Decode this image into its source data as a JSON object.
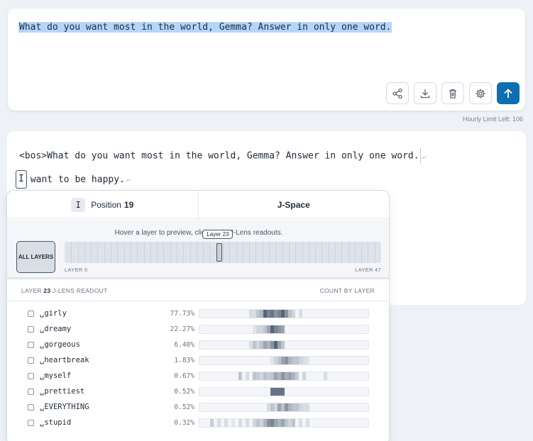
{
  "prompt": {
    "text": "What do you want most in the world, Gemma? Answer in only one word."
  },
  "toolbar": {
    "buttons": [
      "share-icon",
      "download-icon",
      "trash-icon",
      "gear-icon",
      "arrow-up-icon"
    ]
  },
  "limit_text": "Hourly Limit Left: 106",
  "output": {
    "line1": "<bos>What do you want most in the world, Gemma? Answer in only one word.",
    "newline_mark": "↵",
    "selected_token": "I",
    "line2": "want to be happy."
  },
  "panel": {
    "tab_position_chip": "I",
    "tab_position_label": "Position",
    "tab_position_value": "19",
    "tab_jspace": "J-Space",
    "hint": "Hover a layer to preview, click to pin J-Lens readouts.",
    "all_layers_label": "ALL LAYERS",
    "layer_tooltip": "Layer 23",
    "layer_min_label": "LAYER 0",
    "layer_max_label": "LAYER 47",
    "layer_count": 48,
    "selected_layer": 23,
    "readout_prefix": "LAYER",
    "readout_layer": "23",
    "readout_suffix": "J-LENS READOUT",
    "count_by_layer": "COUNT BY LAYER",
    "colors": {
      "bar": "#46546b",
      "accent": "#0d6fb0",
      "selection": "#b5d6fb"
    },
    "rows": [
      {
        "token": "␣girly",
        "pct": "77.73%",
        "layers": [
          [
            14,
            0.15
          ],
          [
            15,
            0.15
          ],
          [
            16,
            0.3
          ],
          [
            17,
            0.4
          ],
          [
            18,
            0.9
          ],
          [
            19,
            0.7
          ],
          [
            20,
            0.8
          ],
          [
            21,
            0.6
          ],
          [
            22,
            0.7
          ],
          [
            23,
            0.9
          ],
          [
            24,
            0.6
          ],
          [
            25,
            0.3
          ],
          [
            26,
            0.2
          ],
          [
            28,
            0.15
          ]
        ]
      },
      {
        "token": "␣dreamy",
        "pct": "22.27%",
        "layers": [
          [
            15,
            0.1
          ],
          [
            16,
            0.2
          ],
          [
            17,
            0.2
          ],
          [
            18,
            0.3
          ],
          [
            19,
            0.5
          ],
          [
            20,
            0.9
          ],
          [
            21,
            0.7
          ],
          [
            22,
            0.6
          ],
          [
            23,
            0.5
          ]
        ]
      },
      {
        "token": "␣gorgeous",
        "pct": "6.40%",
        "layers": [
          [
            14,
            0.15
          ],
          [
            15,
            0.3
          ],
          [
            16,
            0.2
          ],
          [
            17,
            0.3
          ],
          [
            18,
            0.5
          ],
          [
            19,
            0.4
          ],
          [
            20,
            0.6
          ],
          [
            21,
            0.9
          ],
          [
            22,
            0.5
          ],
          [
            23,
            0.3
          ]
        ]
      },
      {
        "token": "␣heartbreak",
        "pct": "1.83%",
        "layers": [
          [
            20,
            0.1
          ],
          [
            21,
            0.2
          ],
          [
            22,
            0.3
          ],
          [
            23,
            0.5
          ],
          [
            24,
            0.6
          ],
          [
            25,
            0.4
          ],
          [
            26,
            0.3
          ],
          [
            27,
            0.3
          ],
          [
            28,
            0.2
          ],
          [
            29,
            0.15
          ],
          [
            30,
            0.1
          ]
        ]
      },
      {
        "token": "␣myself",
        "pct": "0.67%",
        "layers": [
          [
            11,
            0.3
          ],
          [
            13,
            0.15
          ],
          [
            15,
            0.3
          ],
          [
            16,
            0.25
          ],
          [
            17,
            0.2
          ],
          [
            18,
            0.3
          ],
          [
            19,
            0.25
          ],
          [
            20,
            0.3
          ],
          [
            21,
            0.5
          ],
          [
            22,
            0.4
          ],
          [
            23,
            0.6
          ],
          [
            24,
            0.45
          ],
          [
            25,
            0.5
          ],
          [
            26,
            0.4
          ],
          [
            27,
            0.25
          ],
          [
            29,
            0.2
          ],
          [
            35,
            0.15
          ]
        ]
      },
      {
        "token": "␣prettiest",
        "pct": "0.52%",
        "layers": [
          [
            20,
            0.8
          ],
          [
            21,
            0.8
          ],
          [
            22,
            0.8
          ],
          [
            23,
            0.8
          ]
        ]
      },
      {
        "token": "␣EVERYTHING",
        "pct": "0.52%",
        "layers": [
          [
            19,
            0.15
          ],
          [
            20,
            0.3
          ],
          [
            21,
            0.2
          ],
          [
            22,
            0.5
          ],
          [
            23,
            0.3
          ],
          [
            24,
            0.6
          ],
          [
            25,
            0.4
          ],
          [
            26,
            0.3
          ],
          [
            27,
            0.3
          ],
          [
            28,
            0.2
          ],
          [
            29,
            0.15
          ],
          [
            30,
            0.15
          ]
        ]
      },
      {
        "token": "␣stupid",
        "pct": "0.32%",
        "layers": [
          [
            3,
            0.25
          ],
          [
            5,
            0.15
          ],
          [
            7,
            0.15
          ],
          [
            9,
            0.1
          ],
          [
            11,
            0.15
          ],
          [
            13,
            0.15
          ],
          [
            15,
            0.2
          ],
          [
            16,
            0.3
          ],
          [
            17,
            0.2
          ],
          [
            18,
            0.4
          ],
          [
            19,
            0.6
          ],
          [
            20,
            0.7
          ],
          [
            21,
            0.5
          ],
          [
            22,
            0.4
          ],
          [
            23,
            0.5
          ],
          [
            24,
            0.3
          ],
          [
            25,
            0.2
          ],
          [
            26,
            0.3
          ],
          [
            28,
            0.15
          ],
          [
            30,
            0.15
          ]
        ]
      }
    ]
  }
}
